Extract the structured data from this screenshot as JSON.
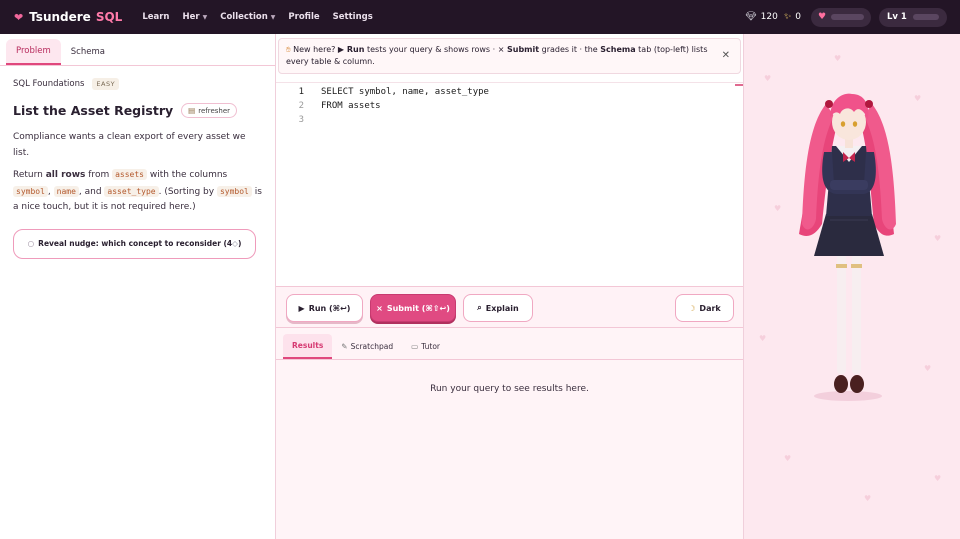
{
  "nav": {
    "brand_name": "Tsundere",
    "brand_accent": "SQL",
    "links": [
      {
        "label": "Learn",
        "dropdown": false
      },
      {
        "label": "Her",
        "dropdown": true
      },
      {
        "label": "Collection",
        "dropdown": true
      },
      {
        "label": "Profile",
        "dropdown": false
      },
      {
        "label": "Settings",
        "dropdown": false
      }
    ],
    "gems": "120",
    "sparkles": "0",
    "level": "Lv 1"
  },
  "left": {
    "tabs": [
      "Problem",
      "Schema"
    ],
    "active_tab": "Problem",
    "course": "SQL Foundations",
    "difficulty": "EASY",
    "title": "List the Asset Registry",
    "refresher_label": "refresher",
    "desc1": "Compliance wants a clean export of every asset we list.",
    "desc2": {
      "t1": "Return ",
      "bold": "all rows",
      "t2": " from ",
      "c1": "assets",
      "t3": " with the columns ",
      "c2": "symbol",
      "t4": ", ",
      "c3": "name",
      "t5": ", and ",
      "c4": "asset_type",
      "t6": ". (Sorting by ",
      "c5": "symbol",
      "t7": " is a nice touch, but it is not required here.)"
    },
    "nudge_label": "Reveal nudge: which concept to reconsider (4 ",
    "nudge_end": ")"
  },
  "banner": {
    "t1": "New here? ",
    "run": "Run",
    "t2": " tests your query & shows rows · ",
    "submit": "Submit",
    "t3": " grades it · the ",
    "schema": "Schema",
    "t4": " tab (top-left) lists every table & column."
  },
  "editor": {
    "lines": [
      {
        "n": "1",
        "text": "SELECT symbol, name, asset_type"
      },
      {
        "n": "2",
        "text": "FROM assets"
      },
      {
        "n": "3",
        "text": ""
      }
    ]
  },
  "toolbar": {
    "run_label": "Run (⌘↩)",
    "submit_label": "Submit (⌘⇧↩)",
    "explain_label": "Explain",
    "dark_label": "Dark"
  },
  "results": {
    "tabs": [
      "Results",
      "Scratchpad",
      "Tutor"
    ],
    "active_tab": "Results",
    "empty_message": "Run your query to see results here."
  },
  "colors": {
    "accent": "#e04a82",
    "nav_bg": "#231526",
    "panel_pink": "#fde8ef"
  },
  "icons": {
    "brand": "heart-icon",
    "gems": "gem-icon",
    "sparkles": "sparkle-icon",
    "close": "close-icon"
  }
}
